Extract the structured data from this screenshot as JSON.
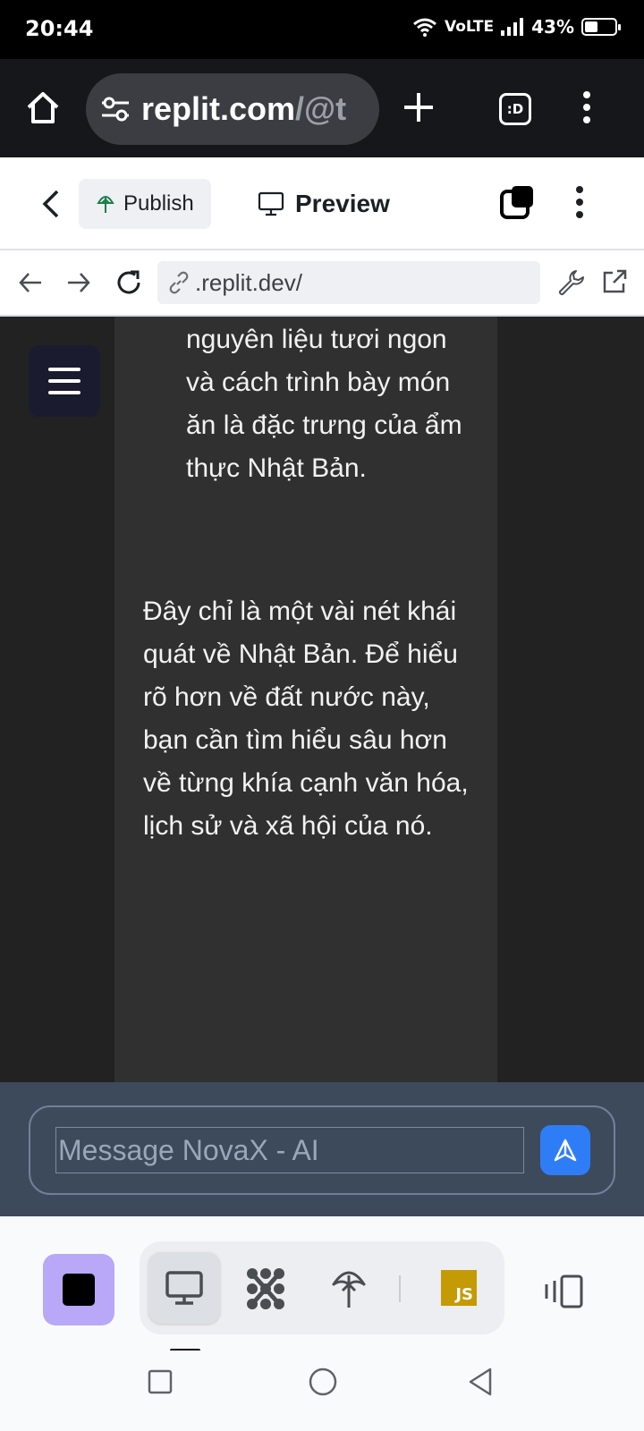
{
  "status_bar": {
    "time": "20:44",
    "network": "VoLTE",
    "battery_percent": 43,
    "battery_text": "43%"
  },
  "browser": {
    "url_host": "replit.com",
    "url_path": "/@t",
    "tab_label": ":D"
  },
  "replit_header": {
    "publish_label": "Publish",
    "preview_label": "Preview"
  },
  "webview_toolbar": {
    "address": ".replit.dev/"
  },
  "chat": {
    "paragraph_1": "nguyên liệu tươi ngon và cách trình bày món ăn là đặc trưng của ẩm thực Nhật Bản.",
    "paragraph_2": "Đây chỉ là một vài nét khái quát về Nhật Bản. Để hiểu rõ hơn về đất nước này, bạn cần tìm hiểu sâu hơn về từng khía cạnh văn hóa, lịch sử và xã hội của nó."
  },
  "composer": {
    "placeholder": "Message NovaX - AI"
  },
  "bottom_toolbar": {
    "js_label": "JS"
  },
  "colors": {
    "accent_blue": "#2f7df6",
    "stop_button": "#b9a7f8",
    "chat_bg": "#222222",
    "bubble_bg": "#303030",
    "composer_bg": "#3d4a5c"
  }
}
